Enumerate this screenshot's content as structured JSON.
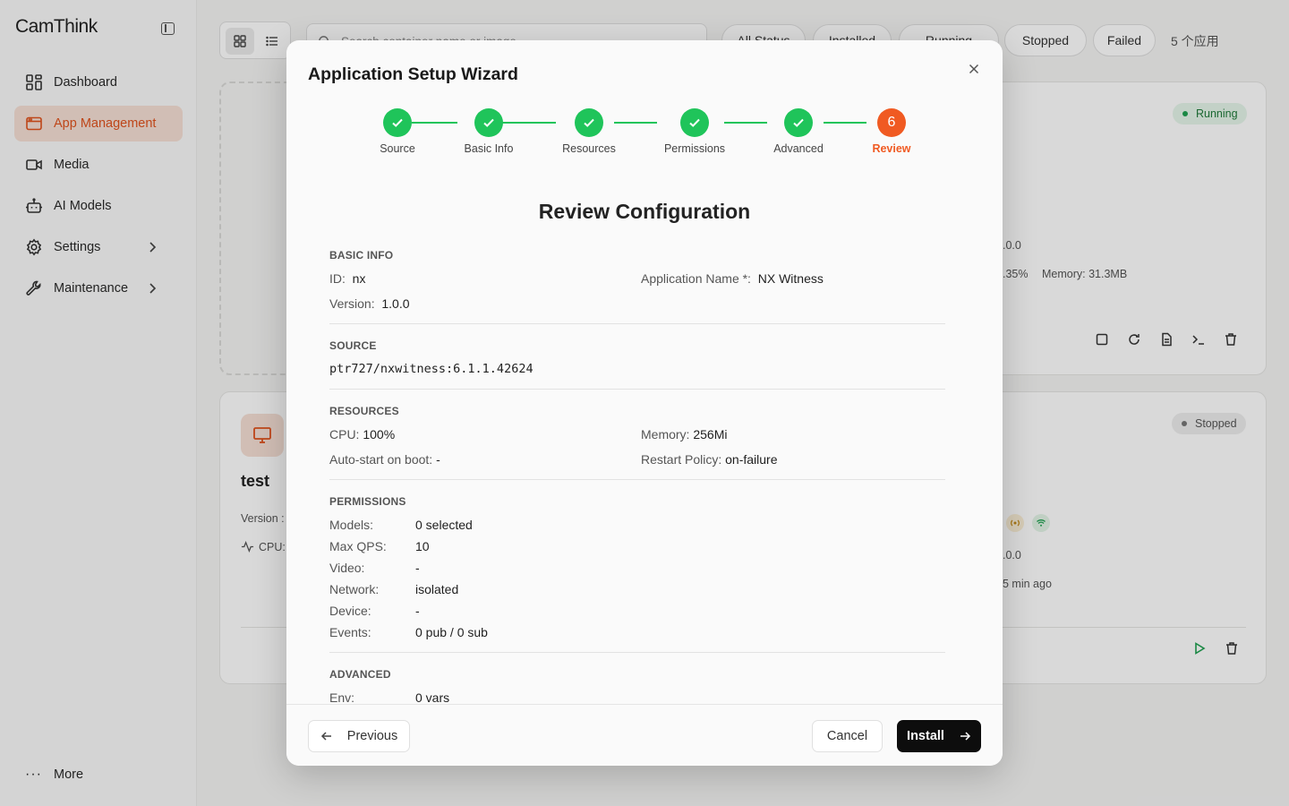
{
  "app": {
    "logo_main": "CamThink",
    "accent_color": "#f05a22"
  },
  "sidebar": {
    "items": [
      {
        "label": "Dashboard",
        "icon": "dashboard-icon"
      },
      {
        "label": "App Management",
        "icon": "app-window-icon",
        "active": true
      },
      {
        "label": "Media",
        "icon": "video-camera-icon"
      },
      {
        "label": "AI Models",
        "icon": "robot-icon"
      },
      {
        "label": "Settings",
        "icon": "gear-icon",
        "has_submenu": true
      },
      {
        "label": "Maintenance",
        "icon": "wrench-icon",
        "has_submenu": true
      }
    ],
    "more_label": "More"
  },
  "toolbar": {
    "search_placeholder": "Search container name or image...",
    "filters": [
      "All Status",
      "Installed",
      "Running",
      "Stopped",
      "Failed"
    ],
    "count_text": "5 个应用"
  },
  "background_cards": {
    "card1": {
      "status": "Running",
      "version_tail": ".0.0",
      "cpu_tail": ".35%",
      "memory": "Memory: 31.3MB"
    },
    "card2": {
      "name": "test",
      "status": "Stopped",
      "version_label": "Version :",
      "cpu_label": "CPU:",
      "version_tail": ".0.0",
      "time": "5 min ago"
    }
  },
  "modal": {
    "title": "Application Setup Wizard",
    "steps": [
      {
        "label": "Source",
        "state": "done"
      },
      {
        "label": "Basic Info",
        "state": "done"
      },
      {
        "label": "Resources",
        "state": "done"
      },
      {
        "label": "Permissions",
        "state": "done"
      },
      {
        "label": "Advanced",
        "state": "done"
      },
      {
        "label": "Review",
        "state": "current",
        "number": "6"
      }
    ],
    "heading": "Review Configuration",
    "basic_info": {
      "title": "BASIC INFO",
      "id_label": "ID:",
      "id_value": "nx",
      "name_label": "Application Name *:",
      "name_value": "NX Witness",
      "version_label": "Version:",
      "version_value": "1.0.0"
    },
    "source": {
      "title": "SOURCE",
      "image": "ptr727/nxwitness:6.1.1.42624"
    },
    "resources": {
      "title": "RESOURCES",
      "cpu_label": "CPU:",
      "cpu_value": "100%",
      "memory_label": "Memory:",
      "memory_value": "256Mi",
      "autostart_label": "Auto-start on boot:",
      "autostart_value": "-",
      "restart_label": "Restart Policy:",
      "restart_value": "on-failure"
    },
    "permissions": {
      "title": "PERMISSIONS",
      "rows": [
        {
          "label": "Models:",
          "value": "0 selected"
        },
        {
          "label": "Max QPS:",
          "value": "10"
        },
        {
          "label": "Video:",
          "value": "-"
        },
        {
          "label": "Network:",
          "value": "isolated"
        },
        {
          "label": "Device:",
          "value": "-"
        },
        {
          "label": "Events:",
          "value": "0 pub / 0 sub"
        }
      ]
    },
    "advanced": {
      "title": "ADVANCED",
      "env_label": "Env:",
      "env_value": "0 vars"
    },
    "footer": {
      "previous_label": "Previous",
      "cancel_label": "Cancel",
      "install_label": "Install"
    }
  }
}
